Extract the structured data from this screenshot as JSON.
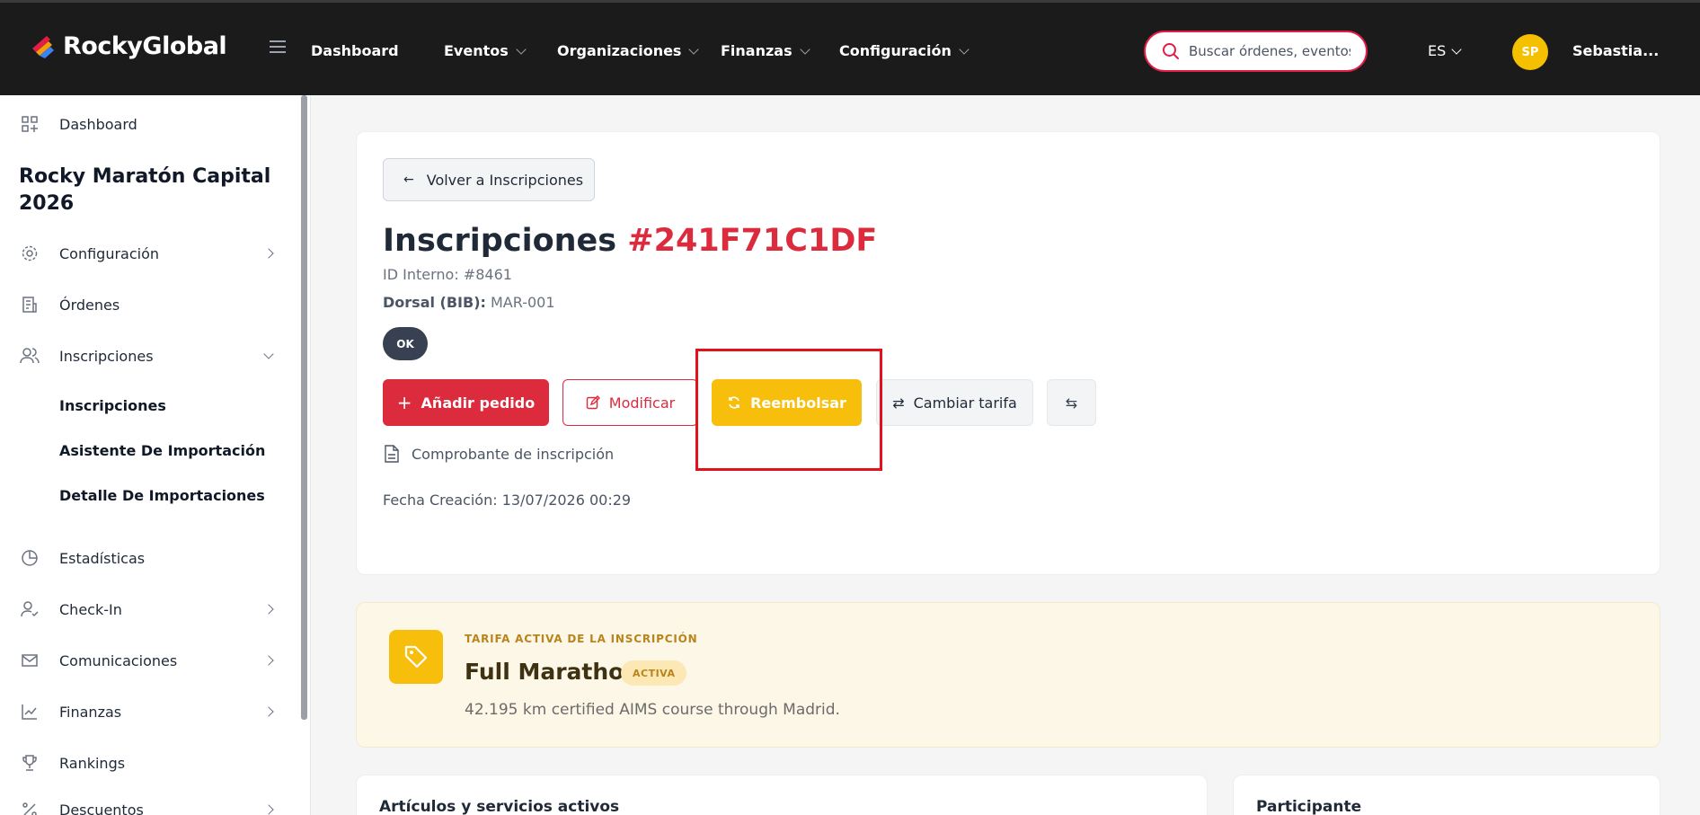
{
  "header": {
    "brand": "RockyGlobal",
    "nav": [
      {
        "label": "Dashboard",
        "has_dropdown": false
      },
      {
        "label": "Eventos",
        "has_dropdown": true
      },
      {
        "label": "Organizaciones",
        "has_dropdown": true
      },
      {
        "label": "Finanzas",
        "has_dropdown": true
      },
      {
        "label": "Configuración",
        "has_dropdown": true
      }
    ],
    "search_placeholder": "Buscar órdenes, eventos",
    "language": "ES",
    "user_initials": "SP",
    "user_name": "Sebastia..."
  },
  "sidebar": {
    "dashboard_label": "Dashboard",
    "event_title": "Rocky Maratón Capital 2026",
    "items": [
      {
        "label": "Configuración",
        "icon": "gear-icon"
      },
      {
        "label": "Órdenes",
        "icon": "orders-icon"
      },
      {
        "label": "Inscripciones",
        "icon": "users-icon"
      },
      {
        "label": "Estadísticas",
        "icon": "pie-chart-icon"
      },
      {
        "label": "Check-In",
        "icon": "user-check-icon"
      },
      {
        "label": "Comunicaciones",
        "icon": "mail-icon"
      },
      {
        "label": "Finanzas",
        "icon": "trend-icon"
      },
      {
        "label": "Rankings",
        "icon": "trophy-icon"
      },
      {
        "label": "Descuentos",
        "icon": "percent-icon"
      }
    ],
    "sub_items": [
      "Inscripciones",
      "Asistente De Importación",
      "Detalle De Importaciones"
    ]
  },
  "main": {
    "back_label": "Volver a Inscripciones",
    "title_prefix": "Inscripciones",
    "title_code": "#241F71C1DF",
    "internal_id": "ID Interno: #8461",
    "bib_label": "Dorsal (BIB):",
    "bib_value": "MAR-001",
    "status": "OK",
    "actions": {
      "add_order": "Añadir pedido",
      "modify": "Modificar",
      "refund": "Reembolsar",
      "change_rate": "Cambiar tarifa"
    },
    "receipt_label": "Comprobante de inscripción",
    "created": "Fecha Creación: 13/07/2026 00:29"
  },
  "rate": {
    "label": "TARIFA ACTIVA DE LA INSCRIPCIÓN",
    "name": "Full Marathon",
    "badge": "ACTIVA",
    "description": "42.195 km certified AIMS course through Madrid."
  },
  "bottom": {
    "items_title": "Artículos y servicios activos",
    "participant_title": "Participante"
  },
  "colors": {
    "brand_red": "#dc2b3c",
    "accent_yellow": "#f7bf0b",
    "dark": "#1b1b1b"
  }
}
